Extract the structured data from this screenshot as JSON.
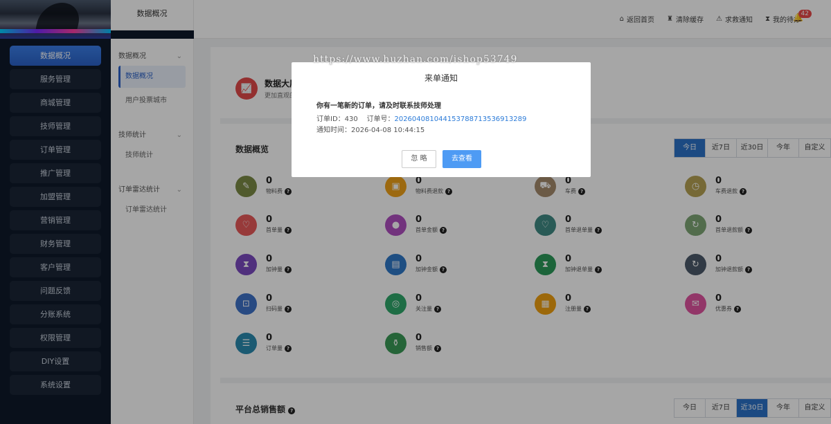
{
  "sidebar": {
    "items": [
      "数据概况",
      "服务管理",
      "商城管理",
      "技师管理",
      "订单管理",
      "推广管理",
      "加盟管理",
      "营销管理",
      "财务管理",
      "客户管理",
      "问题反馈",
      "分账系统",
      "权限管理",
      "DIY设置",
      "系统设置"
    ]
  },
  "subsidebar": {
    "title": "数据概况",
    "groups": [
      {
        "head": "数据概况",
        "links": [
          "数据概况",
          "用户投票城市"
        ]
      },
      {
        "head": "技师统计",
        "links": [
          "技师统计"
        ]
      },
      {
        "head": "订单雷达统计",
        "links": [
          "订单雷达统计"
        ]
      }
    ]
  },
  "header": {
    "actions": [
      {
        "icon": "home-icon",
        "label": "返回首页"
      },
      {
        "icon": "broom-icon",
        "label": "清除缓存"
      },
      {
        "icon": "alert-icon",
        "label": "求救通知"
      },
      {
        "icon": "hourglass-icon",
        "label": "我的待办"
      }
    ],
    "badge": "42"
  },
  "bigscreen": {
    "title": "数据大屏",
    "desc": "更加直观的"
  },
  "overview": {
    "title": "数据概览",
    "tabs": [
      "今日",
      "近7日",
      "近30日",
      "今年",
      "自定义"
    ],
    "active_tab": 0,
    "metrics": [
      {
        "value": "0",
        "label": "物料费",
        "color": "#7b8a45",
        "icon": "tag-icon"
      },
      {
        "value": "0",
        "label": "物料费退款",
        "color": "#f0a21a",
        "icon": "box-icon"
      },
      {
        "value": "0",
        "label": "车费",
        "color": "#a58a6c",
        "icon": "car-icon"
      },
      {
        "value": "0",
        "label": "车费退款",
        "color": "#b5a253",
        "icon": "clock-icon"
      },
      {
        "value": "0",
        "label": "首单量",
        "color": "#e85a5a",
        "icon": "heart-icon"
      },
      {
        "value": "0",
        "label": "首单金额",
        "color": "#b04fc0",
        "icon": "coin-icon"
      },
      {
        "value": "0",
        "label": "首单退单量",
        "color": "#3f8a84",
        "icon": "heart-icon"
      },
      {
        "value": "0",
        "label": "首单退款额",
        "color": "#7ea776",
        "icon": "refresh-icon"
      },
      {
        "value": "0",
        "label": "加钟量",
        "color": "#7b4ac0",
        "icon": "hourglass-icon"
      },
      {
        "value": "0",
        "label": "加钟金额",
        "color": "#2f78c8",
        "icon": "money-icon"
      },
      {
        "value": "0",
        "label": "加钟退单量",
        "color": "#2b9a5a",
        "icon": "hourglass-icon"
      },
      {
        "value": "0",
        "label": "加钟退款额",
        "color": "#4c5a6a",
        "icon": "refresh-icon"
      },
      {
        "value": "0",
        "label": "扫码量",
        "color": "#3e72c8",
        "icon": "scan-icon"
      },
      {
        "value": "0",
        "label": "关注量",
        "color": "#2ea86a",
        "icon": "target-icon"
      },
      {
        "value": "0",
        "label": "注册量",
        "color": "#f0a010",
        "icon": "register-icon"
      },
      {
        "value": "0",
        "label": "优惠券",
        "color": "#e054a0",
        "icon": "coupon-icon"
      },
      {
        "value": "0",
        "label": "订单量",
        "color": "#2a8ab0",
        "icon": "order-icon"
      },
      {
        "value": "0",
        "label": "销售额",
        "color": "#3a9a56",
        "icon": "bag-icon"
      }
    ]
  },
  "sales": {
    "title": "平台总销售额",
    "tabs": [
      "今日",
      "近7日",
      "近30日",
      "今年",
      "自定义"
    ],
    "active_tab": 2
  },
  "modal": {
    "title": "来单通知",
    "message": "你有一笔新的订单，请及时联系技师处理",
    "order_id_label": "订单ID：",
    "order_id": "430",
    "order_no_label": "订单号：",
    "order_no": "202604081044153788713536913289",
    "time_label": "通知时间：",
    "time": "2026-04-08 10:44:15",
    "ignore_label": "忽 略",
    "view_label": "去查看"
  },
  "watermark": "https://www.huzhan.com/ishop53749"
}
